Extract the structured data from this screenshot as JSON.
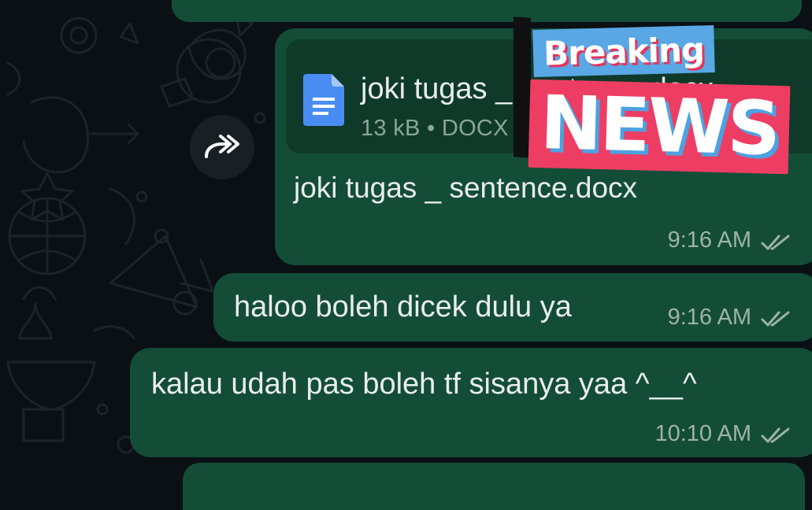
{
  "chat": {
    "messages": [
      {
        "kind": "document",
        "file": {
          "name": "joki tugas _ sentence.docx",
          "size_label": "13 kB • DOCX",
          "icon": "google-docs-icon"
        },
        "caption": "joki tugas _ sentence.docx",
        "time": "9:16 AM",
        "status": "double-check-read"
      },
      {
        "kind": "text",
        "text": "haloo boleh dicek dulu ya",
        "time": "9:16 AM",
        "status": "double-check-read"
      },
      {
        "kind": "text",
        "text": "kalau udah pas boleh tf sisanya yaa ^__^",
        "time": "10:10 AM",
        "status": "double-check-read"
      }
    ],
    "forward_icon": "forward-icon"
  },
  "sticker": {
    "top_text": "Breaking",
    "bottom_text": "NEWS",
    "colors": {
      "top_bg": "#5aa7e6",
      "bottom_bg": "#ee3d63"
    }
  },
  "theme": {
    "background": "#0b1014",
    "bubble_outgoing": "#144d37",
    "doc_card": "#0f3a2a",
    "text": "#e9edef",
    "meta": "#9db3a9",
    "doc_icon": "#4a8df2"
  }
}
